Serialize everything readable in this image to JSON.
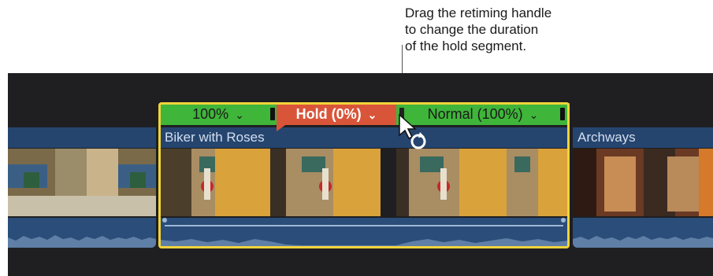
{
  "callout": {
    "lines": [
      "Drag the retiming handle",
      "to change the duration",
      "of the hold segment."
    ]
  },
  "retime": {
    "seg1_label": "100%",
    "seg2_label": "Hold (0%)",
    "seg3_label": "Normal (100%)",
    "chevron": "⌄"
  },
  "clips": {
    "main_label": "Biker with Roses",
    "right_label": "Archways"
  },
  "icons": {
    "cursor": "retime-cursor-icon",
    "chevron": "chevron-down-icon"
  },
  "colors": {
    "green": "#3fb53a",
    "hold_red": "#d9553a",
    "selection": "#f2d43a",
    "clip_blue": "#25456f"
  }
}
